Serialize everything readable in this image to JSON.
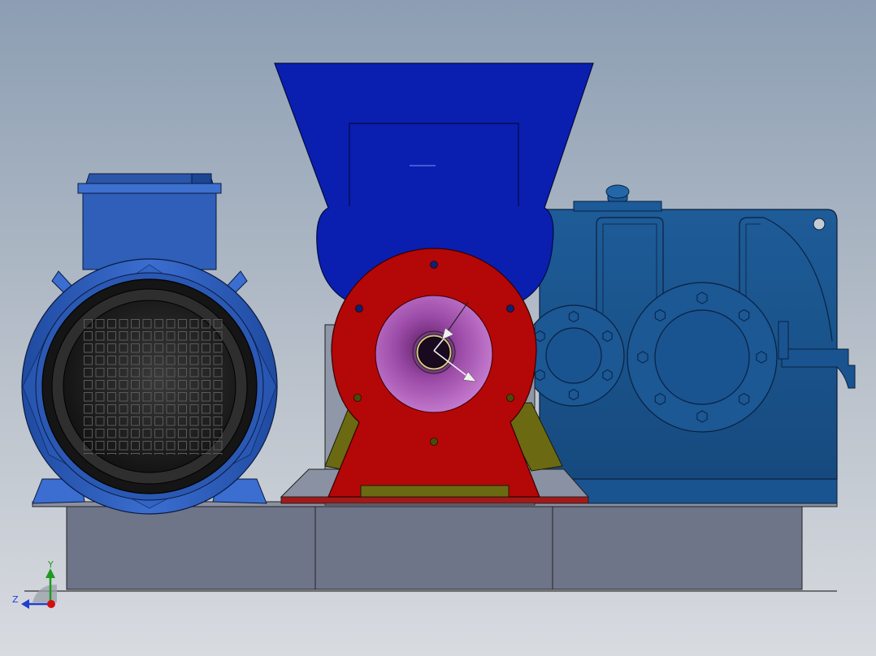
{
  "viewport": {
    "background_top": "#8d9fb3",
    "background_bottom": "#d6dadf"
  },
  "model": {
    "components": [
      {
        "name": "electric-motor",
        "color": "#2f5fb8"
      },
      {
        "name": "feed-hopper",
        "color": "#0a1fb0"
      },
      {
        "name": "pump-housing",
        "color": "#b40707"
      },
      {
        "name": "pump-bore",
        "color": "#b060b8"
      },
      {
        "name": "support-bracket",
        "color": "#6b6a12"
      },
      {
        "name": "gear-reducer",
        "color": "#1a5490"
      },
      {
        "name": "base-frame",
        "color": "#6e7589"
      }
    ]
  },
  "triad": {
    "y_label": "Y",
    "z_label": "Z",
    "y_color": "#1f9a1f",
    "z_color": "#1f3fd0",
    "x_color": "#d01010"
  }
}
